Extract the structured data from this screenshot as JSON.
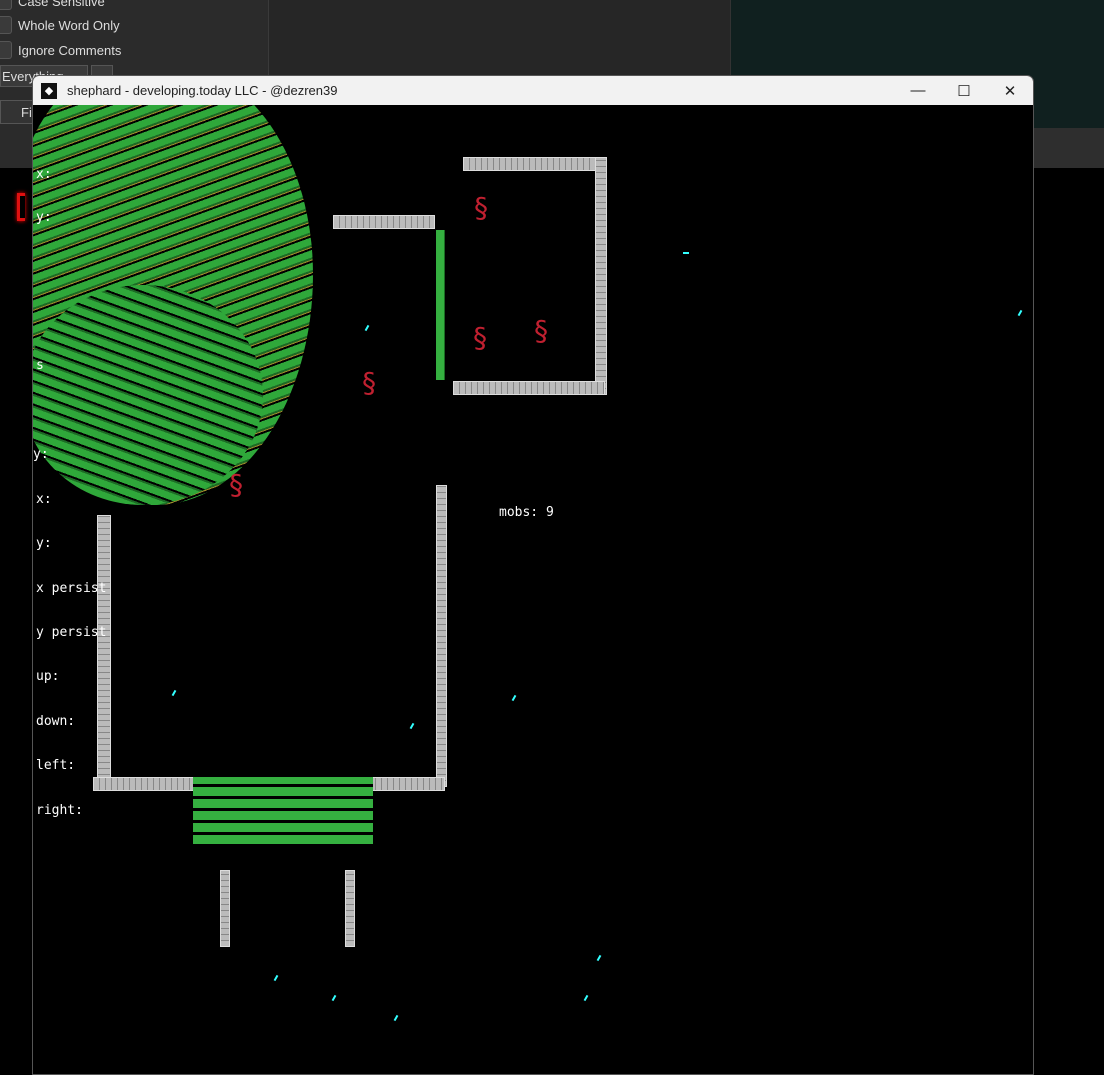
{
  "background_panel": {
    "options": [
      {
        "label": "Case Sensitive"
      },
      {
        "label": "Whole Word Only"
      },
      {
        "label": "Ignore Comments"
      }
    ],
    "scope_select": "Everything",
    "find_button": "Find"
  },
  "window": {
    "title": "shephard - developing.today LLC - @dezren39",
    "controls": {
      "minimize": "—",
      "maximize": "☐",
      "close": "✕"
    }
  },
  "game": {
    "hud_labels": [
      "x:",
      "y:",
      "s",
      "y:",
      "x:",
      "y:",
      "x persist",
      "y persist",
      "up:",
      "down:",
      "left:",
      "right:"
    ],
    "mobs_label": "mobs: 9",
    "colors": {
      "grass": "#2fa83a",
      "wall": "#bbbbbb",
      "mob": "#c02030",
      "spark": "#33ffff"
    }
  }
}
